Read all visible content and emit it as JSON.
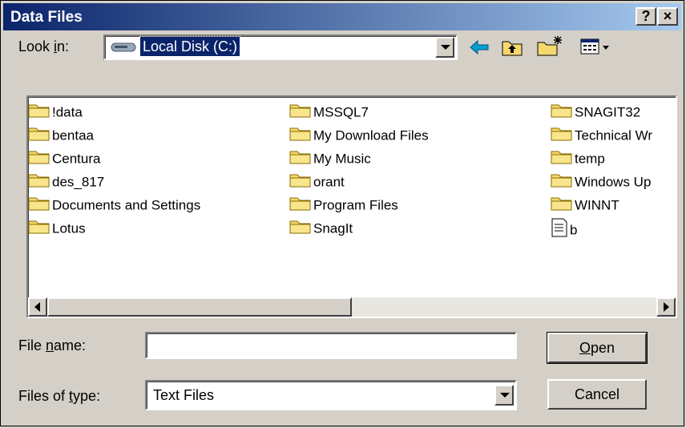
{
  "window": {
    "title": "Data Files",
    "help_glyph": "?",
    "close_glyph": "×"
  },
  "lookin": {
    "label_pre": "Look ",
    "label_key": "i",
    "label_post": "n:",
    "value": "Local Disk (C:)"
  },
  "files": {
    "col1": [
      "!data",
      "bentaa",
      "Centura",
      "des_817",
      "Documents and Settings",
      "Lotus"
    ],
    "col2": [
      "MSSQL7",
      "My Download Files",
      "My Music",
      "orant",
      "Program Files",
      "SnagIt"
    ],
    "col3": [
      "SNAGIT32",
      "Technical Wr",
      "temp",
      "Windows Up",
      "WINNT"
    ],
    "text_file": "b"
  },
  "filename": {
    "label_pre": "File ",
    "label_key": "n",
    "label_post": "ame:",
    "value": ""
  },
  "filetype": {
    "label_pre": "Files of ",
    "label_key": "t",
    "label_post": "ype:",
    "value": "Text Files"
  },
  "buttons": {
    "open_key": "O",
    "open_rest": "pen",
    "cancel": "Cancel"
  },
  "colors": {
    "title_start": "#0a246a",
    "title_end": "#a6caf0",
    "face": "#d4d0c8",
    "folder": "#f5d76e"
  }
}
